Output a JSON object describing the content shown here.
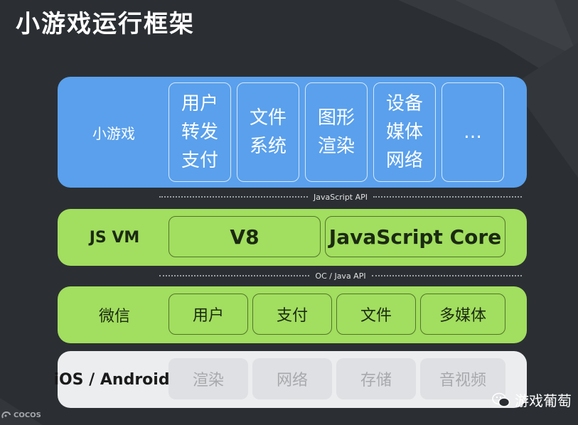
{
  "title": "小游戏运行框架",
  "layers": {
    "game": {
      "label": "小游戏",
      "items": [
        {
          "lines": [
            "用户",
            "转发",
            "支付"
          ]
        },
        {
          "lines": [
            "文件",
            "系统"
          ]
        },
        {
          "lines": [
            "图形",
            "渲染"
          ]
        },
        {
          "lines": [
            "设备",
            "媒体",
            "网络"
          ]
        },
        {
          "lines": [
            "…"
          ]
        }
      ]
    },
    "js_api": "JavaScript API",
    "vm": {
      "label": "JS VM",
      "items": [
        "V8",
        "JavaScript Core"
      ]
    },
    "native_api": "OC / Java API",
    "wechat": {
      "label": "微信",
      "items": [
        "用户",
        "支付",
        "文件",
        "多媒体"
      ]
    },
    "os": {
      "label": "iOS / Android",
      "items": [
        "渲染",
        "网络",
        "存储",
        "音视频"
      ]
    }
  },
  "footer": {
    "logo": "COCOS",
    "watermark": "游戏葡萄"
  },
  "colors": {
    "background": "#2b2f33",
    "game_layer": "#5aa0ec",
    "vm_layer": "#a2de5f",
    "wechat_layer": "#a2de5f",
    "os_layer": "#ecedef"
  }
}
